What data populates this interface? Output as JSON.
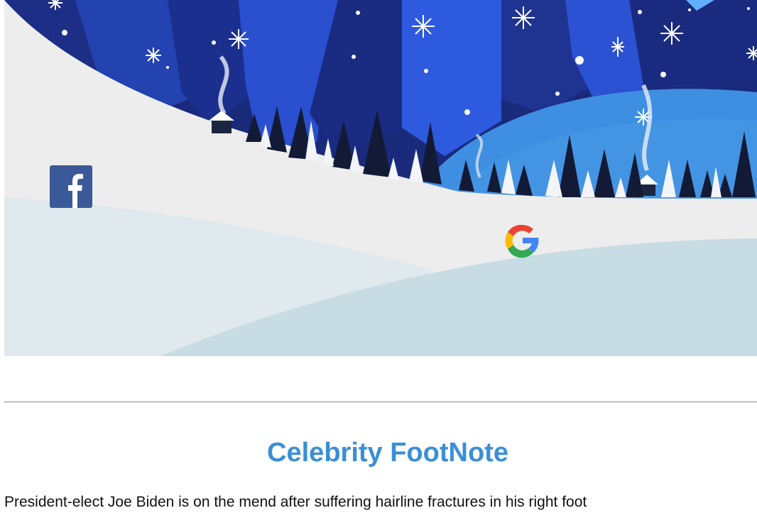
{
  "banner": {
    "facebook_icon": "facebook-icon",
    "google_icon": "google-icon",
    "colors": {
      "sky_dark": "#16226b",
      "sky_mid": "#2447c0",
      "sky_light": "#3a6ee8",
      "hill_blue": "#3d8ee0",
      "snow": "#efefef",
      "foreground_snow": "#c7dce3"
    }
  },
  "section": {
    "title": "Celebrity FootNote",
    "body": "President-elect Joe Biden is on the mend after suffering hairline fractures in his right foot"
  },
  "colors": {
    "title": "#3a8fd6",
    "text": "#111111",
    "divider": "#8a8a8a"
  }
}
